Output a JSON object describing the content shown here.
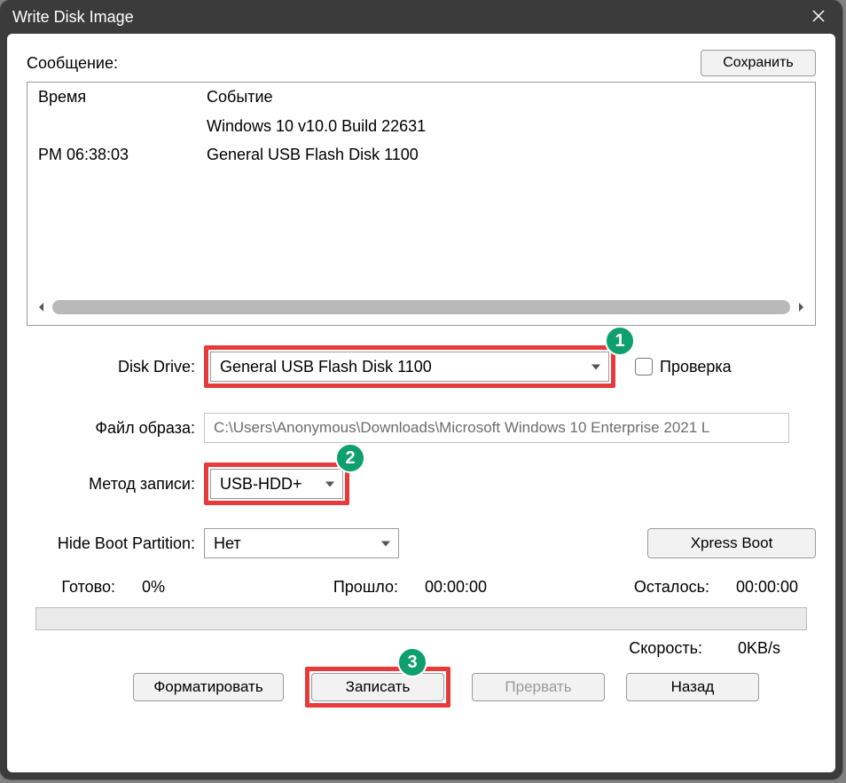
{
  "window": {
    "title": "Write Disk Image"
  },
  "message_label": "Сообщение:",
  "save_button": "Сохранить",
  "log": {
    "col1": "Время",
    "col2": "Событие",
    "rows": [
      {
        "time": "",
        "event": "Windows 10 v10.0 Build 22631"
      },
      {
        "time": "PM 06:38:03",
        "event": "General USB Flash Disk  1100"
      }
    ]
  },
  "form": {
    "disk_drive_label": "Disk Drive:",
    "disk_drive_value": "General USB Flash Disk  1100",
    "check_label": "Проверка",
    "image_file_label": "Файл образа:",
    "image_file_value": "C:\\Users\\Anonymous\\Downloads\\Microsoft Windows 10 Enterprise 2021 L",
    "write_method_label": "Метод записи:",
    "write_method_value": "USB-HDD+",
    "hide_boot_label": "Hide Boot Partition:",
    "hide_boot_value": "Нет",
    "xpress_boot": "Xpress Boot"
  },
  "status": {
    "ready_label": "Готово:",
    "ready_value": "0%",
    "elapsed_label": "Прошло:",
    "elapsed_value": "00:00:00",
    "remain_label": "Осталось:",
    "remain_value": "00:00:00",
    "speed_label": "Скорость:",
    "speed_value": "0KB/s"
  },
  "buttons": {
    "format": "Форматировать",
    "write": "Записать",
    "abort": "Прервать",
    "back": "Назад"
  },
  "annotations": {
    "b1": "1",
    "b2": "2",
    "b3": "3"
  }
}
